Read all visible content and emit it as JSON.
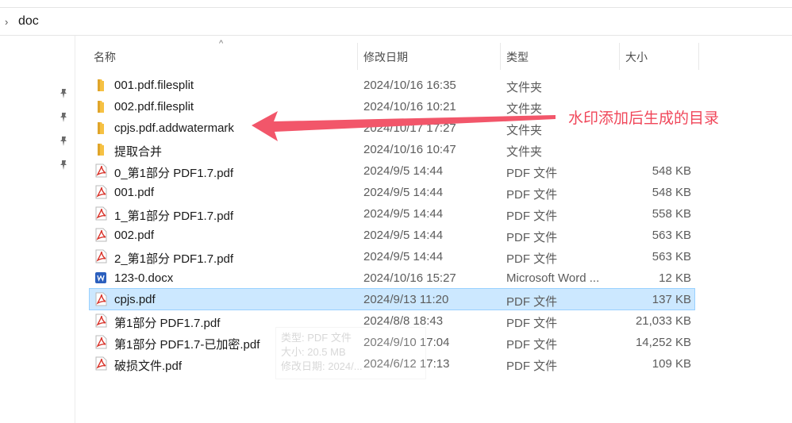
{
  "breadcrumb": {
    "current": "doc"
  },
  "columns": {
    "name": "名称",
    "modified": "修改日期",
    "type": "类型",
    "size": "大小"
  },
  "files": [
    {
      "name": "001.pdf.filesplit",
      "modified": "2024/10/16 16:35",
      "type": "文件夹",
      "size": "",
      "icon": "folder-icon"
    },
    {
      "name": "002.pdf.filesplit",
      "modified": "2024/10/16 10:21",
      "type": "文件夹",
      "size": "",
      "icon": "folder-icon"
    },
    {
      "name": "cpjs.pdf.addwatermark",
      "modified": "2024/10/17 17:27",
      "type": "文件夹",
      "size": "",
      "icon": "folder-icon"
    },
    {
      "name": "提取合并",
      "modified": "2024/10/16 10:47",
      "type": "文件夹",
      "size": "",
      "icon": "folder-icon"
    },
    {
      "name": "0_第1部分 PDF1.7.pdf",
      "modified": "2024/9/5 14:44",
      "type": "PDF 文件",
      "size": "548 KB",
      "icon": "pdf-icon"
    },
    {
      "name": "001.pdf",
      "modified": "2024/9/5 14:44",
      "type": "PDF 文件",
      "size": "548 KB",
      "icon": "pdf-icon"
    },
    {
      "name": "1_第1部分 PDF1.7.pdf",
      "modified": "2024/9/5 14:44",
      "type": "PDF 文件",
      "size": "558 KB",
      "icon": "pdf-icon"
    },
    {
      "name": "002.pdf",
      "modified": "2024/9/5 14:44",
      "type": "PDF 文件",
      "size": "563 KB",
      "icon": "pdf-icon"
    },
    {
      "name": "2_第1部分 PDF1.7.pdf",
      "modified": "2024/9/5 14:44",
      "type": "PDF 文件",
      "size": "563 KB",
      "icon": "pdf-icon"
    },
    {
      "name": "123-0.docx",
      "modified": "2024/10/16 15:27",
      "type": "Microsoft Word ...",
      "size": "12 KB",
      "icon": "word-icon"
    },
    {
      "name": "cpjs.pdf",
      "modified": "2024/9/13 11:20",
      "type": "PDF 文件",
      "size": "137 KB",
      "icon": "pdf-icon",
      "selected": true
    },
    {
      "name": "第1部分 PDF1.7.pdf",
      "modified": "2024/8/8 18:43",
      "type": "PDF 文件",
      "size": "21,033 KB",
      "icon": "pdf-icon"
    },
    {
      "name": "第1部分 PDF1.7-已加密.pdf",
      "modified": "2024/9/10 17:04",
      "type": "PDF 文件",
      "size": "14,252 KB",
      "icon": "pdf-icon"
    },
    {
      "name": "破损文件.pdf",
      "modified": "2024/6/12 17:13",
      "type": "PDF 文件",
      "size": "109 KB",
      "icon": "pdf-icon"
    }
  ],
  "tooltip": {
    "line1": "类型: PDF 文件",
    "line2": "大小: 20.5 MB",
    "line3": "修改日期: 2024/..."
  },
  "annotation": {
    "text": "水印添加后生成的目录",
    "color": "#f0475a"
  },
  "colors": {
    "selection": "#cce8ff",
    "selection_border": "#99d1ff",
    "folder": "#f6c143",
    "pdf": "#d9342b",
    "word": "#2b5fbd"
  }
}
